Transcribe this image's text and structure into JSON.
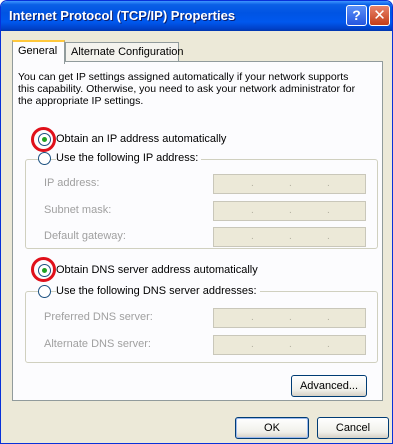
{
  "window": {
    "title": "Internet Protocol (TCP/IP) Properties",
    "help_glyph": "?",
    "close_glyph": "✕"
  },
  "tabs": [
    {
      "label": "General",
      "active": true
    },
    {
      "label": "Alternate Configuration",
      "active": false
    }
  ],
  "description": "You can get IP settings assigned automatically if your network supports this capability. Otherwise, you need to ask your network administrator for the appropriate IP settings.",
  "ip": {
    "auto_label": "Obtain an IP address automatically",
    "manual_label": "Use the following IP address:",
    "auto_selected": true,
    "fields": [
      {
        "label": "IP address:",
        "value": ""
      },
      {
        "label": "Subnet mask:",
        "value": ""
      },
      {
        "label": "Default gateway:",
        "value": ""
      }
    ]
  },
  "dns": {
    "auto_label": "Obtain DNS server address automatically",
    "manual_label": "Use the following DNS server addresses:",
    "auto_selected": true,
    "fields": [
      {
        "label": "Preferred DNS server:",
        "value": ""
      },
      {
        "label": "Alternate DNS server:",
        "value": ""
      }
    ]
  },
  "buttons": {
    "advanced": "Advanced...",
    "ok": "OK",
    "cancel": "Cancel"
  },
  "colors": {
    "titlebar": "#0054e3",
    "highlight_circle": "#e0101a",
    "radio_dot": "#21a121"
  },
  "icons": [
    "help-icon",
    "close-icon"
  ]
}
